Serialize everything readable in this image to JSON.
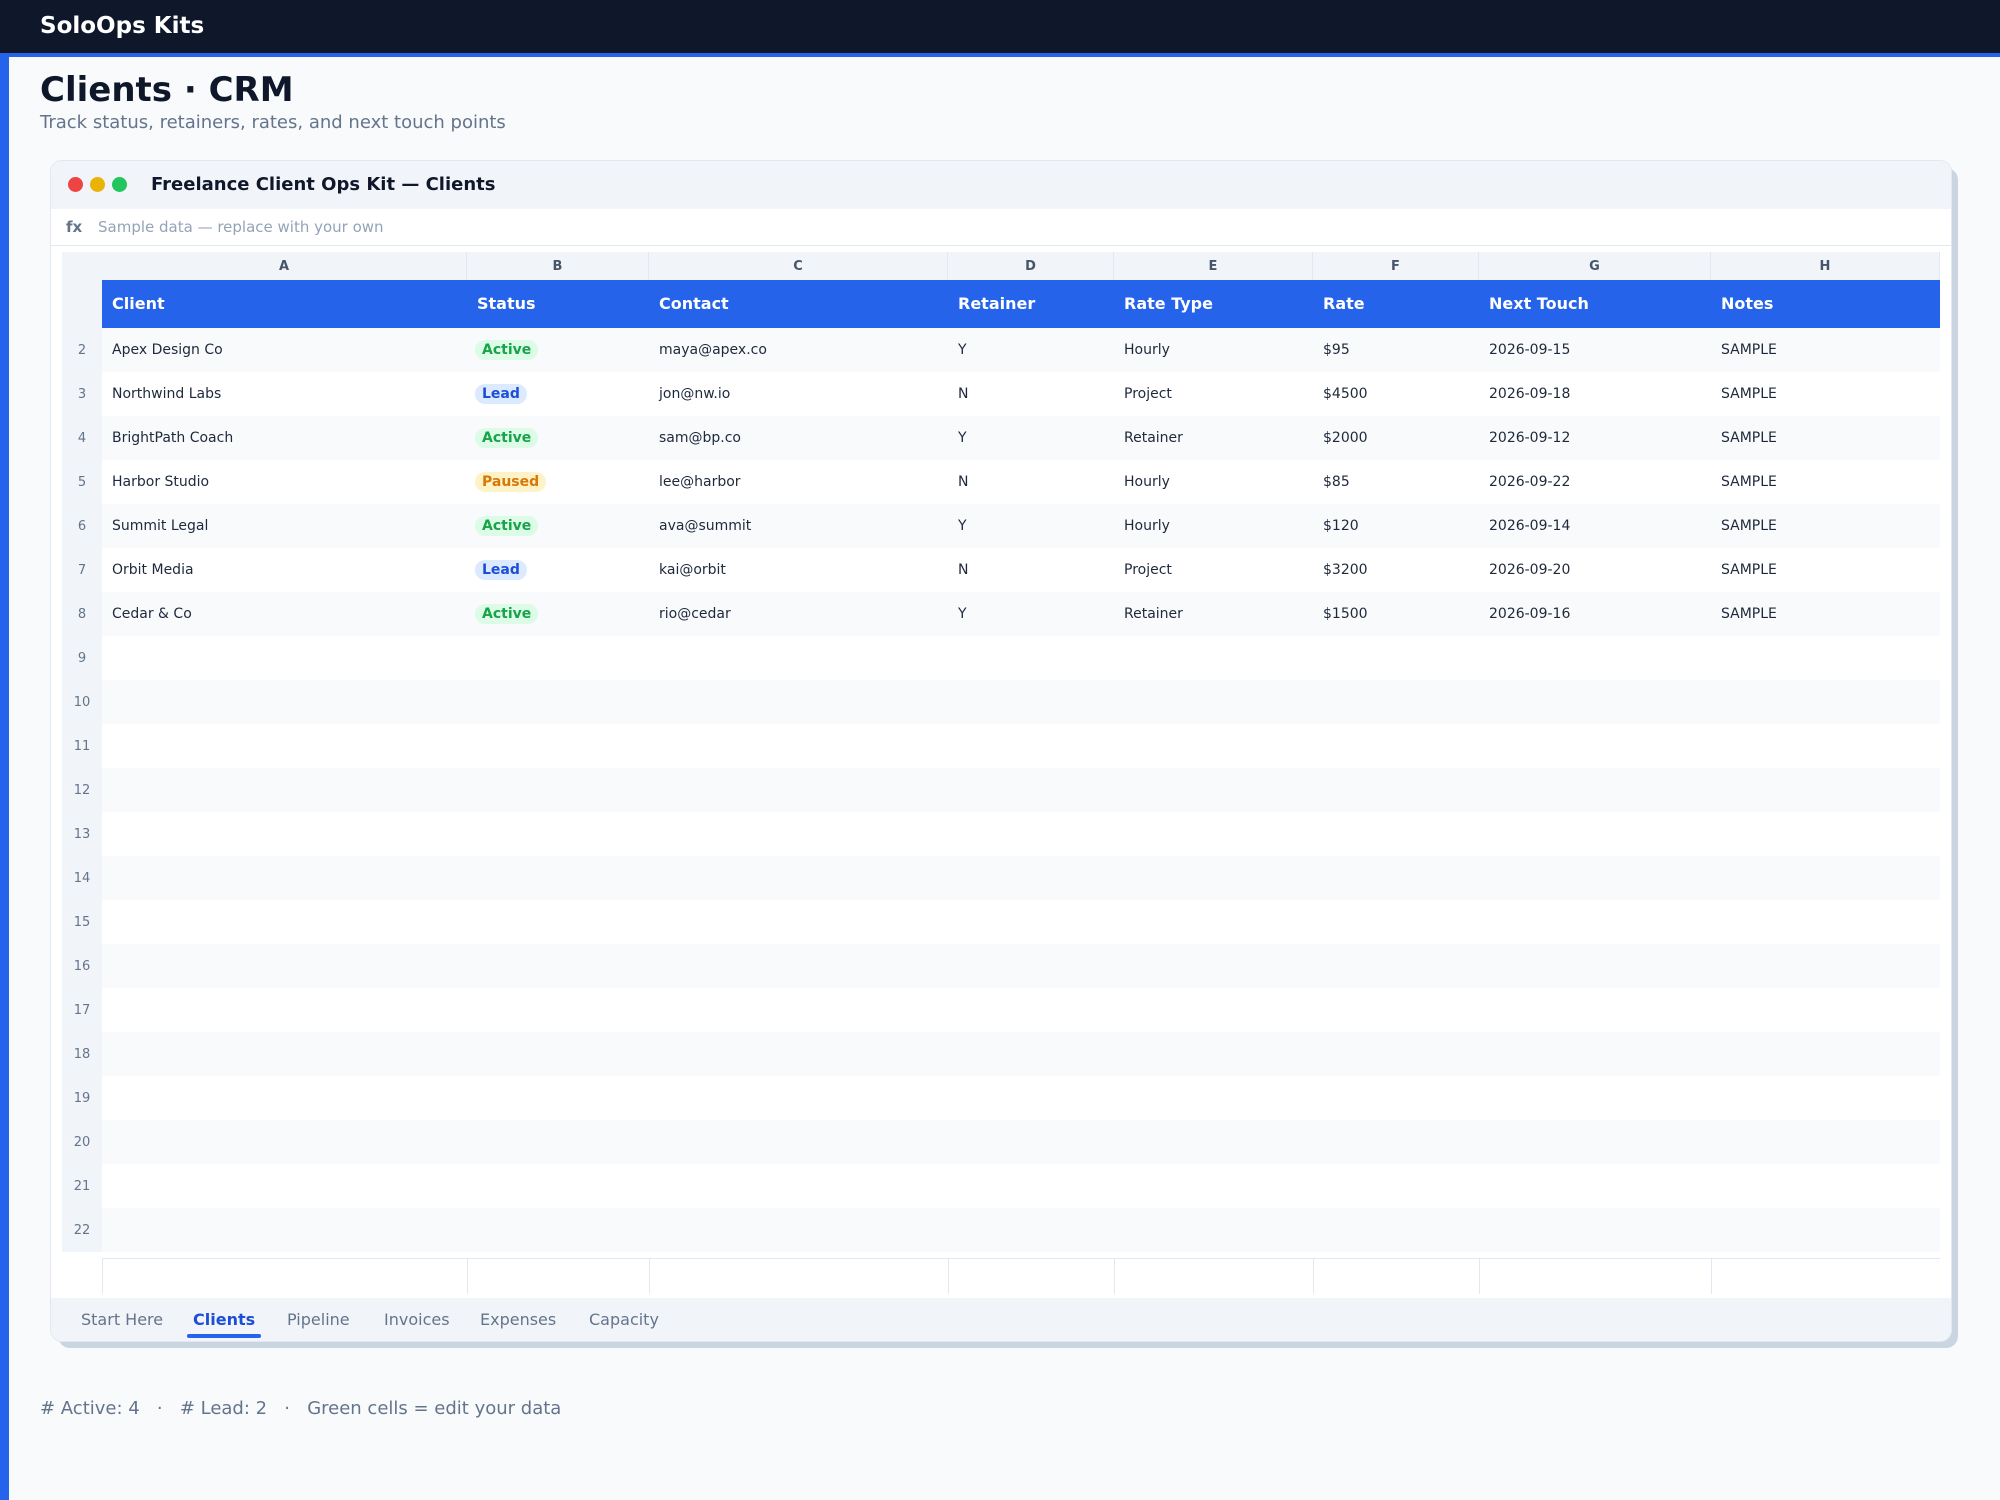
{
  "app": {
    "brand": "SoloOps Kits"
  },
  "page": {
    "title": "Clients · CRM",
    "subtitle": "Track status, retainers, rates, and next touch points"
  },
  "window": {
    "title": "Freelance Client Ops Kit — Clients"
  },
  "formula": {
    "label": "fx",
    "text": "Sample data — replace with your own"
  },
  "columns": [
    "A",
    "B",
    "C",
    "D",
    "E",
    "F",
    "G",
    "H"
  ],
  "headers": [
    "Client",
    "Status",
    "Contact",
    "Retainer",
    "Rate Type",
    "Rate",
    "Next Touch",
    "Notes"
  ],
  "rows": [
    {
      "num": "2",
      "client": "Apex Design Co",
      "status": "Active",
      "contact": "maya@apex.co",
      "retainer": "Y",
      "rate_type": "Hourly",
      "rate": "$95",
      "next_touch": "2026-09-15",
      "notes": "SAMPLE"
    },
    {
      "num": "3",
      "client": "Northwind Labs",
      "status": "Lead",
      "contact": "jon@nw.io",
      "retainer": "N",
      "rate_type": "Project",
      "rate": "$4500",
      "next_touch": "2026-09-18",
      "notes": "SAMPLE"
    },
    {
      "num": "4",
      "client": "BrightPath Coach",
      "status": "Active",
      "contact": "sam@bp.co",
      "retainer": "Y",
      "rate_type": "Retainer",
      "rate": "$2000",
      "next_touch": "2026-09-12",
      "notes": "SAMPLE"
    },
    {
      "num": "5",
      "client": "Harbor Studio",
      "status": "Paused",
      "contact": "lee@harbor",
      "retainer": "N",
      "rate_type": "Hourly",
      "rate": "$85",
      "next_touch": "2026-09-22",
      "notes": "SAMPLE"
    },
    {
      "num": "6",
      "client": "Summit Legal",
      "status": "Active",
      "contact": "ava@summit",
      "retainer": "Y",
      "rate_type": "Hourly",
      "rate": "$120",
      "next_touch": "2026-09-14",
      "notes": "SAMPLE"
    },
    {
      "num": "7",
      "client": "Orbit Media",
      "status": "Lead",
      "contact": "kai@orbit",
      "retainer": "N",
      "rate_type": "Project",
      "rate": "$3200",
      "next_touch": "2026-09-20",
      "notes": "SAMPLE"
    },
    {
      "num": "8",
      "client": "Cedar & Co",
      "status": "Active",
      "contact": "rio@cedar",
      "retainer": "Y",
      "rate_type": "Retainer",
      "rate": "$1500",
      "next_touch": "2026-09-16",
      "notes": "SAMPLE"
    }
  ],
  "empty_rows": [
    "9",
    "10",
    "11",
    "12",
    "13",
    "14",
    "15",
    "16",
    "17",
    "18",
    "19",
    "20",
    "21",
    "22"
  ],
  "tabs": [
    {
      "label": "Start Here",
      "active": false
    },
    {
      "label": "Clients",
      "active": true
    },
    {
      "label": "Pipeline",
      "active": false
    },
    {
      "label": "Invoices",
      "active": false
    },
    {
      "label": "Expenses",
      "active": false
    },
    {
      "label": "Capacity",
      "active": false
    }
  ],
  "footer": {
    "active_count": "# Active: 4",
    "separator": "·",
    "lead_count": "# Lead: 2",
    "hint": "Green cells = edit your data"
  },
  "colors": {
    "accent": "#2563eb",
    "topbar": "#0f172a",
    "active_badge": "#16a34a",
    "lead_badge": "#1d4ed8",
    "paused_badge": "#d97706"
  }
}
